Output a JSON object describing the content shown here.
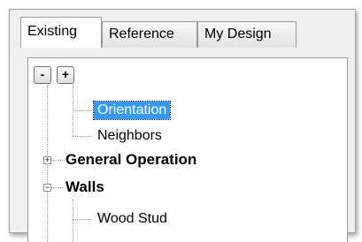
{
  "tabs": [
    {
      "label": "Existing",
      "active": true
    },
    {
      "label": "Reference",
      "active": false
    },
    {
      "label": "My Design",
      "active": false
    }
  ],
  "toolbar": {
    "collapse_label": "-",
    "expand_label": "+"
  },
  "tree": {
    "items": [
      {
        "label": "Orientation",
        "selected": true
      },
      {
        "label": "Neighbors"
      },
      {
        "label": "General Operation",
        "expander": "+"
      },
      {
        "label": "Walls",
        "expander": "−"
      },
      {
        "label": "Wood Stud"
      }
    ]
  },
  "colors": {
    "selection": "#3399ff",
    "tree_lines": "#a0a0a0"
  }
}
